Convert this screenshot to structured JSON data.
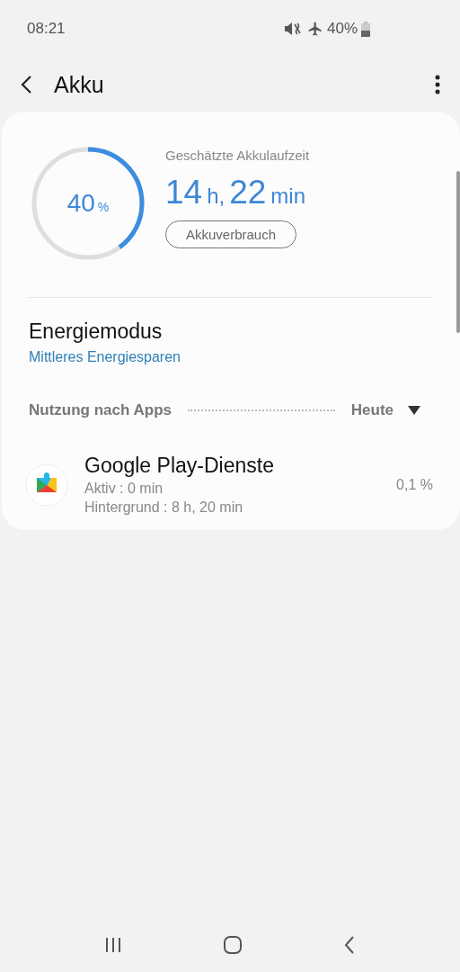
{
  "status_bar": {
    "time": "08:21",
    "battery": "40%"
  },
  "header": {
    "title": "Akku"
  },
  "battery": {
    "percent": "40",
    "unit": "%",
    "level": 0.4,
    "estimate_label": "Geschätzte Akkulaufzeit",
    "estimate": [
      {
        "text": "14",
        "kind": "number"
      },
      {
        "text": "h,",
        "kind": "unit"
      },
      {
        "text": "22",
        "kind": "number"
      },
      {
        "text": "min",
        "kind": "unit"
      }
    ],
    "usage_button": "Akkuverbrauch"
  },
  "power_mode": {
    "title": "Energiemodus",
    "value": "Mittleres Energiesparen"
  },
  "usage": {
    "label": "Nutzung nach Apps",
    "period": "Heute"
  },
  "apps": [
    {
      "name": "Google Play-Dienste",
      "active": "Aktiv : 0 min",
      "background": "Hintergrund : 8 h, 20 min",
      "share": "0,1 %"
    }
  ]
}
